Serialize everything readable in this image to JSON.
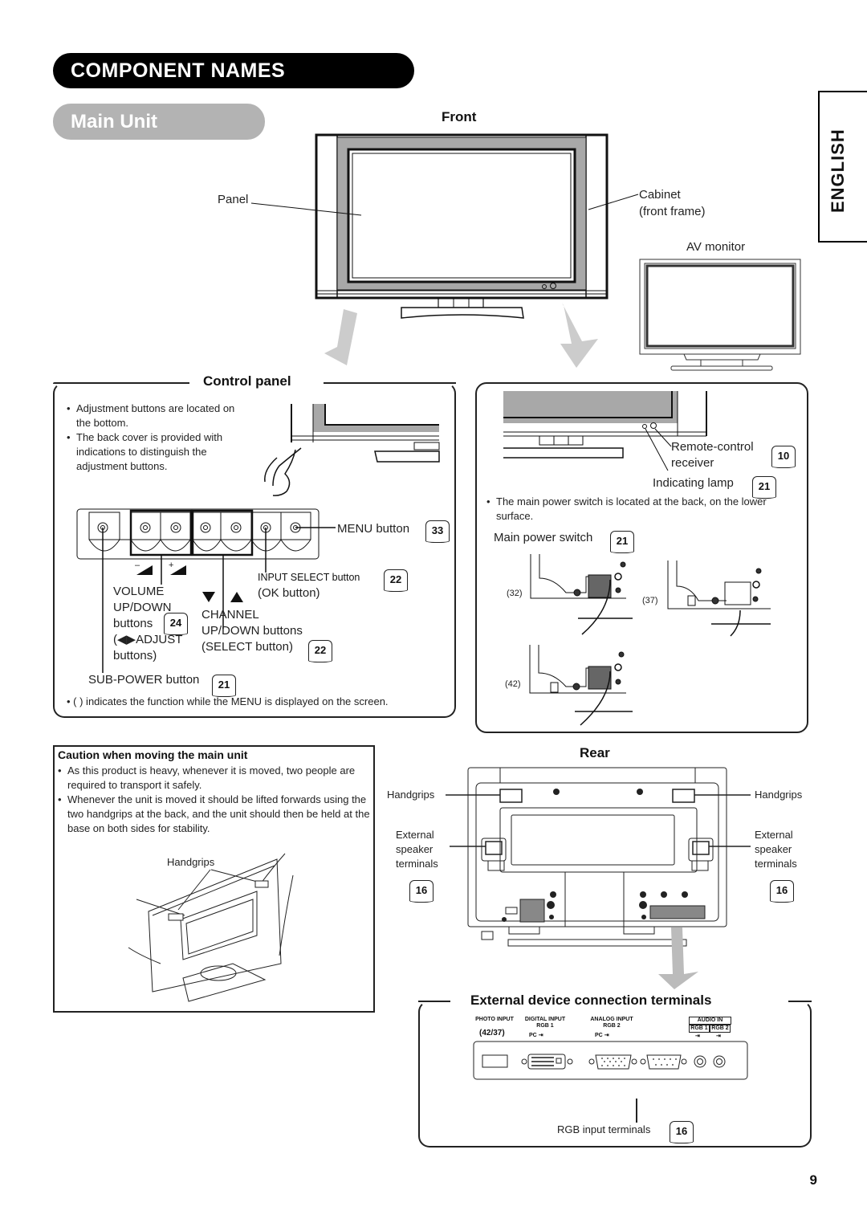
{
  "page": {
    "title": "COMPONENT NAMES",
    "subtitle": "Main Unit",
    "language_tab": "ENGLISH",
    "page_number": "9"
  },
  "front": {
    "heading": "Front",
    "panel_label": "Panel",
    "cabinet_label_line1": "Cabinet",
    "cabinet_label_line2": "(front frame)",
    "av_monitor_label": "AV monitor"
  },
  "control_panel": {
    "heading": "Control panel",
    "notes": [
      "Adjustment buttons are located on the bottom.",
      "The back cover is provided with indications to distinguish the adjustment buttons."
    ],
    "menu_button": {
      "label": "MENU button",
      "ref": "33"
    },
    "input_select": {
      "label": "INPUT SELECT button",
      "sub": "(OK button)",
      "ref": "22"
    },
    "volume": {
      "line1": "VOLUME",
      "line2": "UP/DOWN",
      "line3": "buttons",
      "line4": "(◀▶ADJUST",
      "line5": "buttons)",
      "ref": "24"
    },
    "channel": {
      "line1": "CHANNEL",
      "line2": "UP/DOWN buttons",
      "line3": "(SELECT button)",
      "ref": "22",
      "arrows": "▼  ▲"
    },
    "sub_power": {
      "label": "SUB-POWER button",
      "ref": "21"
    },
    "footnote": "(    ) indicates the function while the MENU is displayed on the screen.",
    "vol_minus": "–",
    "vol_plus": "+"
  },
  "indicators": {
    "remote_line1": "Remote-control",
    "remote_line2": "receiver",
    "remote_ref": "10",
    "lamp_label": "Indicating lamp",
    "lamp_ref": "21",
    "power_note": "The main power switch is located at the back, on the lower surface.",
    "power_switch_label": "Main power switch",
    "power_switch_ref": "21",
    "sizes": [
      "(32)",
      "(37)",
      "(42)"
    ]
  },
  "caution": {
    "heading": "Caution when moving the main unit",
    "items": [
      "As this product is heavy, whenever it is moved, two people are required to transport it safely.",
      "Whenever the unit is moved it should be lifted forwards using the two handgrips at the back, and the unit should then be held at the base on both sides for stability."
    ],
    "handgrips_label": "Handgrips"
  },
  "rear": {
    "heading": "Rear",
    "handgrips_left": "Handgrips",
    "handgrips_right": "Handgrips",
    "speaker_left": [
      "External",
      "speaker",
      "terminals"
    ],
    "speaker_right": [
      "External",
      "speaker",
      "terminals"
    ],
    "speaker_ref_left": "16",
    "speaker_ref_right": "16"
  },
  "terminals": {
    "heading": "External device connection terminals",
    "photo_input": "PHOTO INPUT",
    "photo_sizes": "(42/37)",
    "digital_input": "DIGITAL INPUT",
    "digital_rgb": "RGB 1",
    "analog_input": "ANALOG INPUT",
    "analog_rgb": "RGB 2",
    "pc_label": "PC",
    "audio_in": "AUDIO IN",
    "audio_rgb1": "RGB 1",
    "audio_rgb2": "RGB 2",
    "rgb_input_label": "RGB input terminals",
    "rgb_input_ref": "16"
  }
}
